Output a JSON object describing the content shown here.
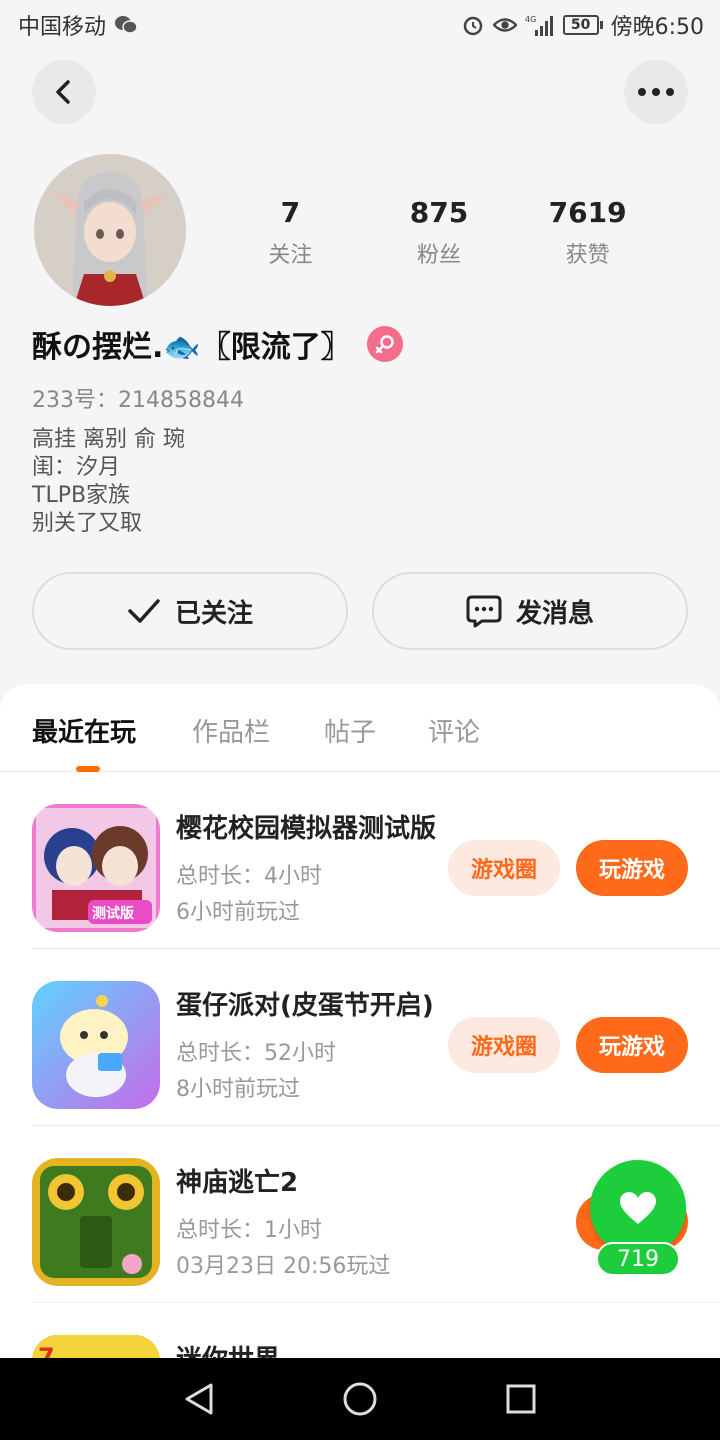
{
  "status_bar": {
    "carrier": "中国移动",
    "network": "4G",
    "battery": "50",
    "time": "傍晚6:50"
  },
  "profile": {
    "stats": [
      {
        "value": "7",
        "label": "关注"
      },
      {
        "value": "875",
        "label": "粉丝"
      },
      {
        "value": "7619",
        "label": "获赞"
      }
    ],
    "nickname": "酥の摆烂.🐟〖限流了〗",
    "uid_label": "233号：",
    "uid": "214858844",
    "bio_lines": [
      "高挂 离别 俞 琬",
      "闺：汐月",
      "TLPB家族",
      "别关了又取"
    ]
  },
  "actions": {
    "follow_label": "已关注",
    "message_label": "发消息"
  },
  "tabs": [
    "最近在玩",
    "作品栏",
    "帖子",
    "评论"
  ],
  "games": [
    {
      "title": "樱花校园模拟器测试版",
      "duration": "总时长：4小时",
      "last_played": "6小时前玩过",
      "circle_label": "游戏圈",
      "play_label": "玩游戏"
    },
    {
      "title": "蛋仔派对(皮蛋节开启)",
      "duration": "总时长：52小时",
      "last_played": "8小时前玩过",
      "circle_label": "游戏圈",
      "play_label": "玩游戏"
    },
    {
      "title": "神庙逃亡2",
      "duration": "总时长：1小时",
      "last_played": "03月23日 20:56玩过",
      "play_label": "玩游戏"
    },
    {
      "title": "迷你世界"
    }
  ],
  "like_widget": {
    "count": "719"
  },
  "colors": {
    "accent": "#ff6a1a",
    "like_green": "#1dcd3b",
    "gender_pink": "#f46d8a"
  }
}
